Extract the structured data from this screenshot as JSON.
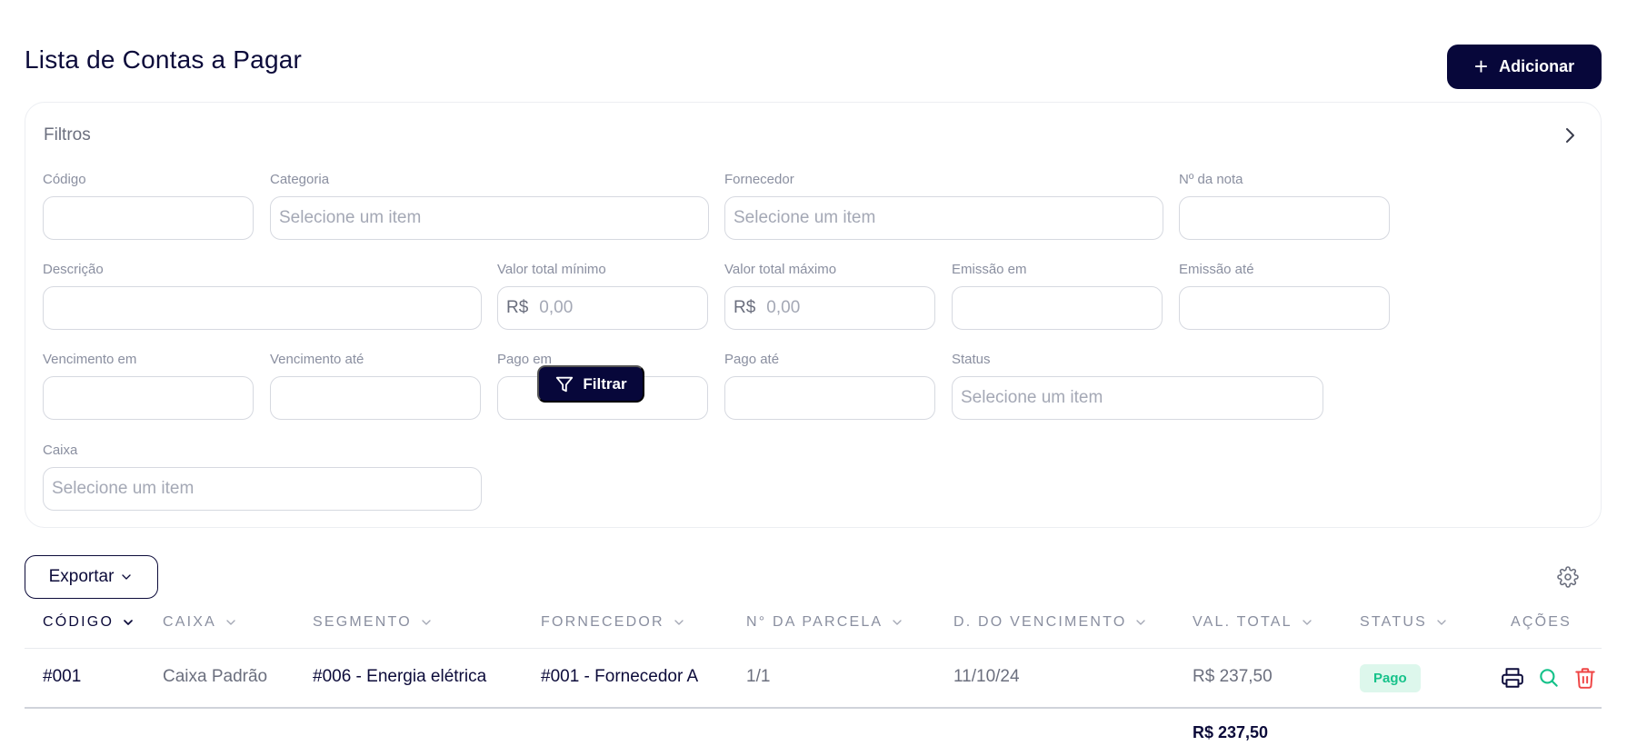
{
  "header": {
    "title": "Lista de Contas a Pagar",
    "add_label": "Adicionar"
  },
  "filters": {
    "title": "Filtros",
    "codigo": {
      "label": "Código",
      "value": ""
    },
    "categoria": {
      "label": "Categoria",
      "placeholder": "Selecione um item"
    },
    "fornecedor": {
      "label": "Fornecedor",
      "placeholder": "Selecione um item"
    },
    "nota": {
      "label": "Nº da nota",
      "value": ""
    },
    "descricao": {
      "label": "Descrição",
      "value": ""
    },
    "valor_min": {
      "label": "Valor total mínimo",
      "prefix": "R$",
      "placeholder": "0,00"
    },
    "valor_max": {
      "label": "Valor total máximo",
      "prefix": "R$",
      "placeholder": "0,00"
    },
    "emissao_em": {
      "label": "Emissão em",
      "value": ""
    },
    "emissao_ate": {
      "label": "Emissão até",
      "value": ""
    },
    "vencimento_em": {
      "label": "Vencimento em",
      "value": ""
    },
    "vencimento_ate": {
      "label": "Vencimento até",
      "value": ""
    },
    "pago_em": {
      "label": "Pago em",
      "value": ""
    },
    "pago_ate": {
      "label": "Pago até",
      "value": ""
    },
    "status": {
      "label": "Status",
      "placeholder": "Selecione um item"
    },
    "caixa": {
      "label": "Caixa",
      "placeholder": "Selecione um item"
    },
    "filter_label": "Filtrar"
  },
  "toolbar": {
    "export_label": "Exportar"
  },
  "table": {
    "columns": [
      "CÓDIGO",
      "CAIXA",
      "SEGMENTO",
      "FORNECEDOR",
      "N° DA PARCELA",
      "D. DO VENCIMENTO",
      "VAL. TOTAL",
      "STATUS",
      "AÇÕES"
    ],
    "rows": [
      {
        "codigo": "#001",
        "caixa": "Caixa Padrão",
        "segmento": "#006 - Energia elétrica",
        "fornecedor": "#001 - Fornecedor A",
        "parcela": "1/1",
        "vencimento": "11/10/24",
        "valor": "R$ 237,50",
        "status": "Pago"
      }
    ],
    "total": "R$ 237,50"
  },
  "colors": {
    "primary": "#07073a",
    "status_paid_bg": "#ddf7ec",
    "status_paid_fg": "#16c28a",
    "delete": "#ef4444",
    "search": "#16c28a"
  },
  "icons": [
    "plus-icon",
    "chevron-right-icon",
    "filter-icon",
    "chevron-down-icon",
    "gear-icon",
    "printer-icon",
    "search-icon",
    "trash-icon"
  ]
}
